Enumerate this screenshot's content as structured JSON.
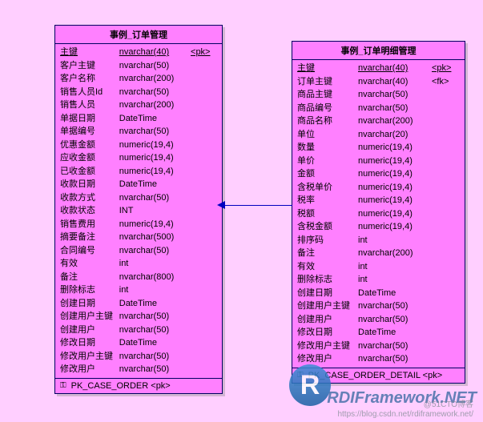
{
  "entity1": {
    "title": "事例_订单管理",
    "rows": [
      {
        "name": "主键",
        "type": "nvarchar(40)",
        "key": "<pk>",
        "und": true
      },
      {
        "name": "客户主键",
        "type": "nvarchar(50)"
      },
      {
        "name": "客户名称",
        "type": "nvarchar(200)"
      },
      {
        "name": "销售人员Id",
        "type": "nvarchar(50)"
      },
      {
        "name": "销售人员",
        "type": "nvarchar(200)"
      },
      {
        "name": "单据日期",
        "type": "DateTime"
      },
      {
        "name": "单据编号",
        "type": "nvarchar(50)"
      },
      {
        "name": "优惠金额",
        "type": "numeric(19,4)"
      },
      {
        "name": "应收金额",
        "type": "numeric(19,4)"
      },
      {
        "name": "已收金额",
        "type": "numeric(19,4)"
      },
      {
        "name": "收款日期",
        "type": "DateTime"
      },
      {
        "name": "收款方式",
        "type": "nvarchar(50)"
      },
      {
        "name": "收款状态",
        "type": "INT"
      },
      {
        "name": "销售费用",
        "type": "numeric(19,4)"
      },
      {
        "name": "摘要备注",
        "type": "nvarchar(500)"
      },
      {
        "name": "合同编号",
        "type": "nvarchar(50)"
      },
      {
        "name": "有效",
        "type": "int"
      },
      {
        "name": "备注",
        "type": "nvarchar(800)"
      },
      {
        "name": "删除标志",
        "type": "int"
      },
      {
        "name": "创建日期",
        "type": "DateTime"
      },
      {
        "name": "创建用户主键",
        "type": "nvarchar(50)"
      },
      {
        "name": "创建用户",
        "type": "nvarchar(50)"
      },
      {
        "name": "修改日期",
        "type": "DateTime"
      },
      {
        "name": "修改用户主键",
        "type": "nvarchar(50)"
      },
      {
        "name": "修改用户",
        "type": "nvarchar(50)"
      }
    ],
    "footer": "PK_CASE_ORDER   <pk>"
  },
  "entity2": {
    "title": "事例_订单明细管理",
    "rows": [
      {
        "name": "主键",
        "type": "nvarchar(40)",
        "key": "<pk>",
        "und": true
      },
      {
        "name": "订单主键",
        "type": "nvarchar(40)",
        "key": "<fk>"
      },
      {
        "name": "商品主键",
        "type": "nvarchar(50)"
      },
      {
        "name": "商品编号",
        "type": "nvarchar(50)"
      },
      {
        "name": "商品名称",
        "type": "nvarchar(200)"
      },
      {
        "name": "单位",
        "type": "nvarchar(20)"
      },
      {
        "name": "数量",
        "type": "numeric(19,4)"
      },
      {
        "name": "单价",
        "type": "numeric(19,4)"
      },
      {
        "name": "金额",
        "type": "numeric(19,4)"
      },
      {
        "name": "含税单价",
        "type": "numeric(19,4)"
      },
      {
        "name": "税率",
        "type": "numeric(19,4)"
      },
      {
        "name": "税额",
        "type": "numeric(19,4)"
      },
      {
        "name": "含税金额",
        "type": "numeric(19,4)"
      },
      {
        "name": "排序码",
        "type": "int"
      },
      {
        "name": "备注",
        "type": "nvarchar(200)"
      },
      {
        "name": "有效",
        "type": "int"
      },
      {
        "name": "删除标志",
        "type": "int"
      },
      {
        "name": "创建日期",
        "type": "DateTime"
      },
      {
        "name": "创建用户主键",
        "type": "nvarchar(50)"
      },
      {
        "name": "创建用户",
        "type": "nvarchar(50)"
      },
      {
        "name": "修改日期",
        "type": "DateTime"
      },
      {
        "name": "修改用户主键",
        "type": "nvarchar(50)"
      },
      {
        "name": "修改用户",
        "type": "nvarchar(50)"
      }
    ],
    "footer": "PK_CASE_ORDER_DETAIL   <pk>"
  },
  "watermark": {
    "badge": "R",
    "text": "RDIFramework.NET",
    "sub1": "@51CTO博客",
    "sub2": "https://blog.csdn.net/rdiframework.net/"
  }
}
